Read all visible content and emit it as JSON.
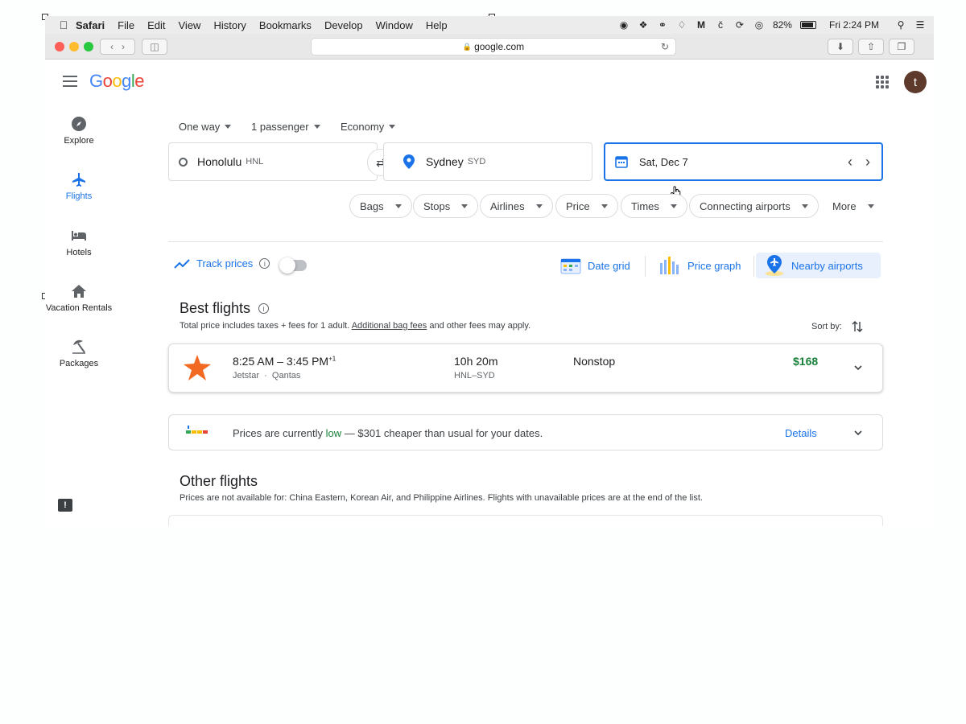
{
  "menubar": {
    "app": "Safari",
    "items": [
      "File",
      "Edit",
      "View",
      "History",
      "Bookmarks",
      "Develop",
      "Window",
      "Help"
    ],
    "battery": "82%",
    "clock": "Fri 2:24 PM"
  },
  "browser": {
    "url": "google.com"
  },
  "header": {
    "logo": "Google",
    "avatar_letter": "t"
  },
  "nav": {
    "items": [
      {
        "label": "Explore",
        "icon": "compass-icon"
      },
      {
        "label": "Flights",
        "icon": "plane-icon",
        "active": true
      },
      {
        "label": "Hotels",
        "icon": "bed-icon"
      },
      {
        "label": "Vacation Rentals",
        "icon": "house-icon"
      },
      {
        "label": "Packages",
        "icon": "umbrella-icon"
      }
    ]
  },
  "search": {
    "trip_type": "One way",
    "passengers": "1 passenger",
    "cabin": "Economy",
    "origin": {
      "city": "Honolulu",
      "code": "HNL"
    },
    "destination": {
      "city": "Sydney",
      "code": "SYD"
    },
    "date": "Sat, Dec 7"
  },
  "filters": [
    "Bags",
    "Stops",
    "Airlines",
    "Price",
    "Times",
    "Connecting airports",
    "More"
  ],
  "tools": {
    "track_prices": "Track prices",
    "date_grid": "Date grid",
    "price_graph": "Price graph",
    "nearby_airports": "Nearby airports"
  },
  "best": {
    "title": "Best flights",
    "note_prefix": "Total price includes taxes + fees for 1 adult.",
    "note_link": "Additional bag fees",
    "note_suffix": "and other fees may apply.",
    "sort_label": "Sort by:"
  },
  "flight": {
    "times": "8:25 AM – 3:45 PM",
    "day_offset": "+1",
    "airline": "Jetstar",
    "partner": "Qantas",
    "duration": "10h 20m",
    "route": "HNL–SYD",
    "stops": "Nonstop",
    "price": "$168"
  },
  "insight": {
    "prefix": "Prices are currently",
    "level": "low",
    "suffix": "— $301 cheaper than usual for your dates.",
    "details": "Details"
  },
  "other": {
    "title": "Other flights",
    "note": "Prices are not available for: China Eastern, Korean Air, and Philippine Airlines. Flights with unavailable prices are at the end of the list."
  },
  "colors": {
    "accent": "#1a73e8",
    "price": "#188038",
    "jetstar": "#f26a21"
  }
}
